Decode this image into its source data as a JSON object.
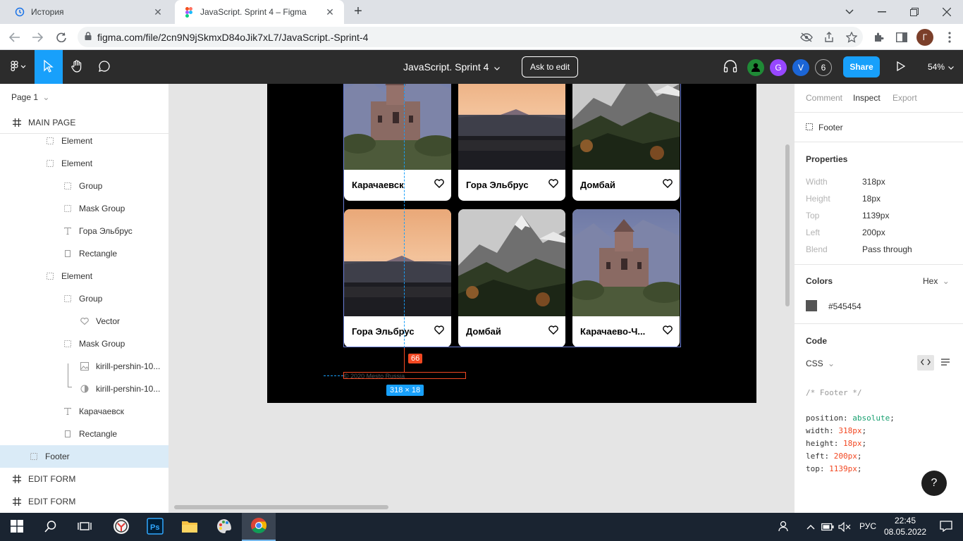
{
  "browser": {
    "tabs": [
      {
        "title": "История",
        "icon": "history-icon"
      },
      {
        "title": "JavaScript. Sprint 4 – Figma",
        "icon": "figma-icon"
      }
    ],
    "url": "figma.com/file/2cn9N9jSkmxD84oJik7xL7/JavaScript.-Sprint-4",
    "profile_initial": "Г"
  },
  "figma_toolbar": {
    "file_title": "JavaScript. Sprint 4",
    "ask_to_edit_label": "Ask to edit",
    "avatars": [
      {
        "initial": "",
        "color": "#1f8a36"
      },
      {
        "initial": "G",
        "color": "#9747ff"
      },
      {
        "initial": "V",
        "color": "#1b65d6"
      },
      {
        "initial": "6",
        "color": "#2c2c2c"
      }
    ],
    "share_label": "Share",
    "zoom_label": "54%"
  },
  "layers_panel": {
    "page_label": "Page 1",
    "layers": [
      {
        "label": "MAIN PAGE",
        "icon": "frame-icon",
        "kind": "frame"
      },
      {
        "label": "Element",
        "icon": "group-icon",
        "kind": "item"
      },
      {
        "label": "Element",
        "icon": "group-icon",
        "kind": "item"
      },
      {
        "label": "Group",
        "icon": "group-icon",
        "kind": "item"
      },
      {
        "label": "Mask Group",
        "icon": "group-icon",
        "kind": "item"
      },
      {
        "label": "Гора Эльбрус",
        "icon": "text-icon",
        "kind": "item"
      },
      {
        "label": "Rectangle",
        "icon": "rectangle-icon",
        "kind": "item"
      },
      {
        "label": "Element",
        "icon": "group-icon",
        "kind": "item"
      },
      {
        "label": "Group",
        "icon": "group-icon",
        "kind": "item"
      },
      {
        "label": "Vector",
        "icon": "vector-icon",
        "kind": "item"
      },
      {
        "label": "Mask Group",
        "icon": "group-icon",
        "kind": "item"
      },
      {
        "label": "kirill-pershin-10...",
        "icon": "image-icon",
        "kind": "item"
      },
      {
        "label": "kirill-pershin-10...",
        "icon": "mask-icon",
        "kind": "item"
      },
      {
        "label": "Карачаевск",
        "icon": "text-icon",
        "kind": "item"
      },
      {
        "label": "Rectangle",
        "icon": "rectangle-icon",
        "kind": "item"
      },
      {
        "label": "Footer",
        "icon": "group-icon",
        "kind": "item",
        "selected": true
      },
      {
        "label": "EDIT FORM",
        "icon": "frame-icon",
        "kind": "frame"
      },
      {
        "label": "EDIT FORM",
        "icon": "frame-icon",
        "kind": "frame"
      }
    ]
  },
  "canvas": {
    "cards": [
      {
        "caption": "Карачаевск",
        "photo": "church"
      },
      {
        "caption": "Гора Эльбрус",
        "photo": "sunset"
      },
      {
        "caption": "Домбай",
        "photo": "mountain"
      },
      {
        "caption": "Гора Эльбрус",
        "photo": "sunset"
      },
      {
        "caption": "Домбай",
        "photo": "mountain"
      },
      {
        "caption": "Карачаево-Ч...",
        "photo": "church"
      }
    ],
    "distance_label": "66",
    "footer_text": "© 2020 Mesto Russia",
    "size_label": "318 × 18"
  },
  "inspect_panel": {
    "tabs": [
      "Comment",
      "Inspect",
      "Export"
    ],
    "active_tab": "Inspect",
    "selected_layer": "Footer",
    "properties_heading": "Properties",
    "properties": [
      {
        "key": "Width",
        "value": "318px"
      },
      {
        "key": "Height",
        "value": "18px"
      },
      {
        "key": "Top",
        "value": "1139px"
      },
      {
        "key": "Left",
        "value": "200px"
      },
      {
        "key": "Blend",
        "value": "Pass through"
      }
    ],
    "colors_heading": "Colors",
    "color_format": "Hex",
    "color_value": "#545454",
    "code_heading": "Code",
    "code_language": "CSS",
    "code": {
      "comment": "/* Footer */",
      "lines": [
        {
          "prop": "position",
          "value": "absolute"
        },
        {
          "prop": "width",
          "value": "318px"
        },
        {
          "prop": "height",
          "value": "18px"
        },
        {
          "prop": "left",
          "value": "200px"
        },
        {
          "prop": "top",
          "value": "1139px"
        }
      ]
    },
    "help_label": "?"
  },
  "taskbar": {
    "language": "РУС",
    "time": "22:45",
    "date": "08.05.2022"
  }
}
